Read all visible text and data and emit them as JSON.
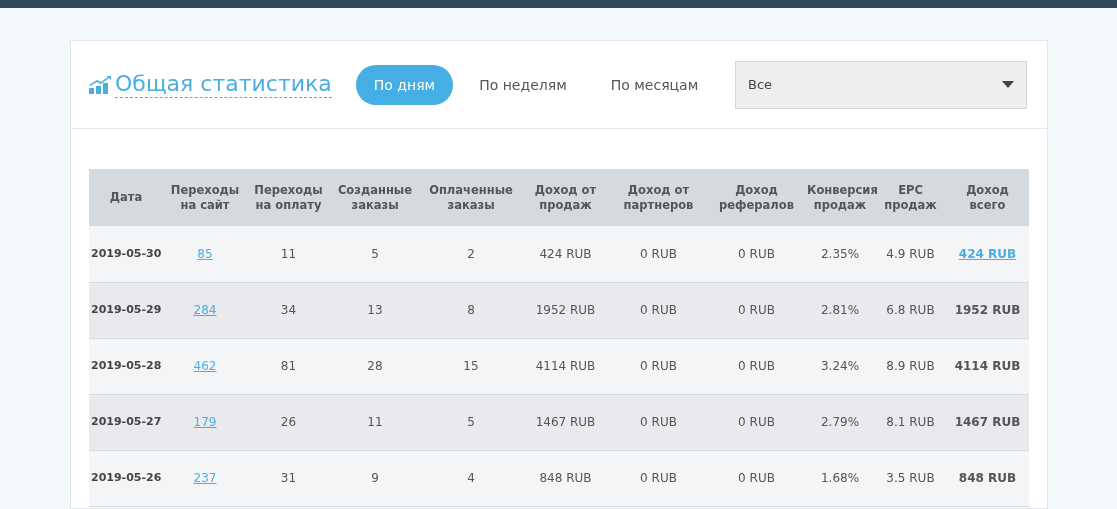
{
  "title": "Общая статистика",
  "tabs": [
    {
      "label": "По дням",
      "selected": true
    },
    {
      "label": "По неделям",
      "selected": false
    },
    {
      "label": "По месяцам",
      "selected": false
    }
  ],
  "filter": {
    "value": "Все"
  },
  "table": {
    "columns": [
      "Дата",
      "Переходы на сайт",
      "Переходы на оплату",
      "Созданные заказы",
      "Оплаченные заказы",
      "Доход от продаж",
      "Доход от партнеров",
      "Доход рефералов",
      "Конверсия продаж",
      "EPC продаж",
      "Доход всего"
    ],
    "rows": [
      {
        "cells": [
          "2019-05-30",
          "85",
          "11",
          "5",
          "2",
          "424 RUB",
          "0 RUB",
          "0 RUB",
          "2.35%",
          "4.9 RUB",
          "424 RUB"
        ],
        "total_linked": true
      },
      {
        "cells": [
          "2019-05-29",
          "284",
          "34",
          "13",
          "8",
          "1952 RUB",
          "0 RUB",
          "0 RUB",
          "2.81%",
          "6.8 RUB",
          "1952 RUB"
        ],
        "total_linked": false
      },
      {
        "cells": [
          "2019-05-28",
          "462",
          "81",
          "28",
          "15",
          "4114 RUB",
          "0 RUB",
          "0 RUB",
          "3.24%",
          "8.9 RUB",
          "4114 RUB"
        ],
        "total_linked": false
      },
      {
        "cells": [
          "2019-05-27",
          "179",
          "26",
          "11",
          "5",
          "1467 RUB",
          "0 RUB",
          "0 RUB",
          "2.79%",
          "8.1 RUB",
          "1467 RUB"
        ],
        "total_linked": false
      },
      {
        "cells": [
          "2019-05-26",
          "237",
          "31",
          "9",
          "4",
          "848 RUB",
          "0 RUB",
          "0 RUB",
          "1.68%",
          "3.5 RUB",
          "848 RUB"
        ],
        "total_linked": false
      }
    ]
  }
}
